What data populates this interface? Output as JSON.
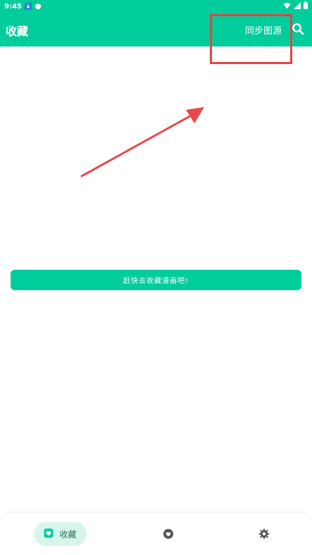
{
  "status_bar": {
    "time": "9:45",
    "left_icons": [
      "download-icon",
      "shield-icon"
    ],
    "right_icons": [
      "wifi-icon",
      "signal-icon",
      "battery-icon"
    ]
  },
  "app_bar": {
    "title": "收藏",
    "sync_label": "同步图源",
    "search_icon": "search-icon"
  },
  "main": {
    "cta_label": "赶快去收藏漫画吧!"
  },
  "bottom_nav": {
    "items": [
      {
        "label": "收藏",
        "icon": "favorites-box-icon",
        "active": true
      },
      {
        "label": "",
        "icon": "heart-icon",
        "active": false
      },
      {
        "label": "",
        "icon": "settings-gear-icon",
        "active": false
      }
    ]
  },
  "colors": {
    "accent": "#00cc9c",
    "annotation": "#e04545",
    "nav_active_bg": "#d8f5ec"
  }
}
